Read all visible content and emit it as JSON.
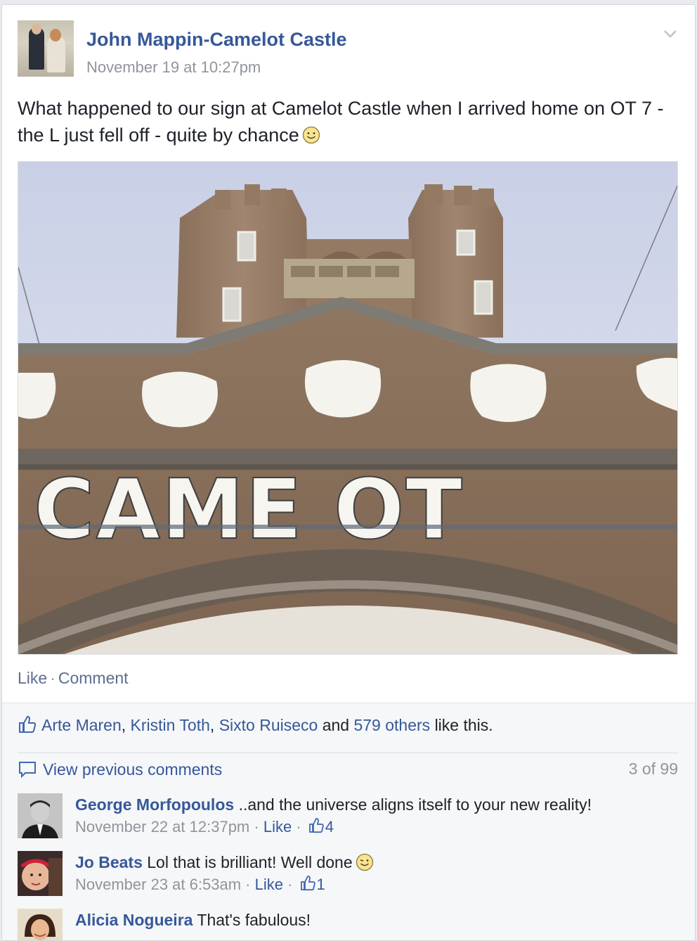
{
  "post": {
    "author": "John Mappin-Camelot Castle",
    "timestamp": "November 19 at 10:27pm",
    "text": "What happened to our sign at Camelot Castle when I arrived home on OT 7 - the L just fell off - quite by chance",
    "photo_sign_text": "CAME OT",
    "actions": {
      "like": "Like",
      "separator": "·",
      "comment": "Comment"
    }
  },
  "feedback": {
    "likers": [
      "Arte Maren",
      "Kristin Toth",
      "Sixto Ruiseco"
    ],
    "comma": ",",
    "and": "and",
    "others": "579 others",
    "suffix": "like this.",
    "view_previous": "View previous comments",
    "comment_count": "3 of 99"
  },
  "comments": [
    {
      "name": "George Morfopoulos",
      "text": "..and the universe aligns itself to your new reality!",
      "time": "November 22 at 12:37pm",
      "like": "Like",
      "likes": "4"
    },
    {
      "name": "Jo Beats",
      "text": "Lol that is brilliant! Well done",
      "time": "November 23 at 6:53am",
      "like": "Like",
      "likes": "1"
    },
    {
      "name": "Alicia Nogueira",
      "text": "That's fabulous!"
    }
  ],
  "colors": {
    "link": "#365899",
    "meta": "#90949c",
    "background": "#e9ebee"
  }
}
